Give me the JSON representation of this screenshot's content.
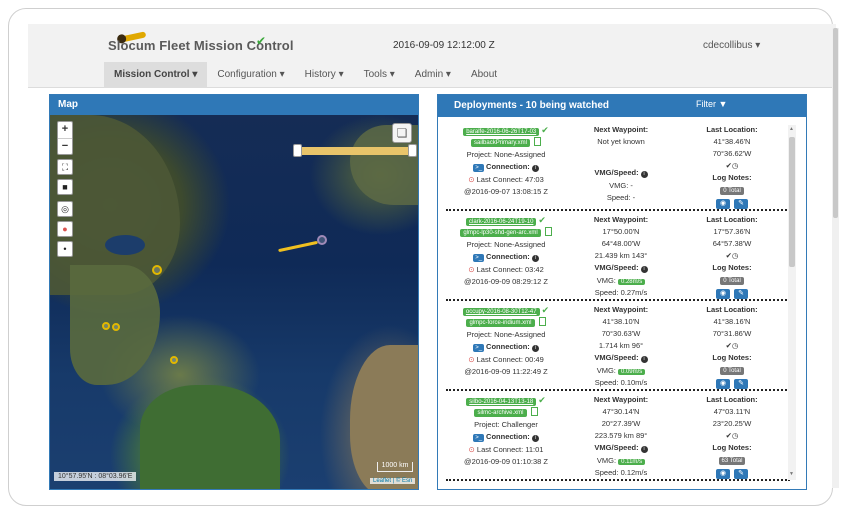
{
  "header": {
    "title": "Slocum Fleet Mission Control",
    "datetime": "2016-09-09 12:12:00 Z",
    "user": "cdecollibus"
  },
  "nav": [
    {
      "label": "Mission Control",
      "active": true
    },
    {
      "label": "Configuration"
    },
    {
      "label": "History"
    },
    {
      "label": "Tools"
    },
    {
      "label": "Admin"
    },
    {
      "label": "About"
    }
  ],
  "map": {
    "title": "Map",
    "coords": "10°57.95'N : 08°03.96'E",
    "scale": "1000 km",
    "attribution": "Leaflet | © Esri"
  },
  "deployments": {
    "title": "Deployments - 10 being watched",
    "filter_label": "Filter",
    "labels": {
      "next_waypoint": "Next Waypoint:",
      "last_location": "Last Location:",
      "connection": "Connection:",
      "vmg_speed": "VMG/Speed:",
      "log_notes": "Log Notes:"
    },
    "items": [
      {
        "name": "baralfe-2016-06-26T17-03",
        "mission_file": "sailbackPrimary.xml",
        "project": "Project: None-Assigned",
        "last_connect": "Last Connect: 47:03",
        "connect_time": "@2016-09-07 13:08:15 Z",
        "waypoint_lines": [
          "Not yet known"
        ],
        "vmg": "VMG: -",
        "speed": "Speed: -",
        "lat": "41°38.46'N",
        "lon": "70°36.62'W",
        "log_total": "0 Total"
      },
      {
        "name": "clark-2016-06-24T19-10",
        "mission_file": "glmpc-lp30-shd-gen-arc.xml",
        "project": "Project: None-Assigned",
        "last_connect": "Last Connect: 03:42",
        "connect_time": "@2016-09-09 08:29:12 Z",
        "waypoint_lines": [
          "17°50.00'N",
          "64°48.00'W",
          "21.439 km 143°"
        ],
        "vmg": "0.28m/s",
        "speed": "Speed: 0.27m/s",
        "lat": "17°57.36'N",
        "lon": "64°57.38'W",
        "log_total": "0 Total"
      },
      {
        "name": "occupy-2016-08-30T12-47",
        "mission_file": "glmpc-force-iridium.xml",
        "project": "Project: None-Assigned",
        "last_connect": "Last Connect: 00:49",
        "connect_time": "@2016-09-09 11:22:49 Z",
        "waypoint_lines": [
          "41°38.10'N",
          "70°30.63'W",
          "1.714 km 96°"
        ],
        "vmg": "0.09m/s",
        "speed": "Speed: 0.10m/s",
        "lat": "41°38.16'N",
        "lon": "70°31.86'W",
        "log_total": "0 Total"
      },
      {
        "name": "silbo-2016-04-13T13-18",
        "mission_file": "silmc-archive.xml",
        "project": "Project: Challenger",
        "last_connect": "Last Connect: 11:01",
        "connect_time": "@2016-09-09 01:10:38 Z",
        "waypoint_lines": [
          "47°30.14'N",
          "20°27.39'W",
          "223.579 km 89°"
        ],
        "vmg": "0.11m/s",
        "speed": "Speed: 0.12m/s",
        "lat": "47°03.11'N",
        "lon": "23°20.25'W",
        "log_total": "63 Total"
      }
    ]
  },
  "colors": {
    "panel_header": "#2f78b7",
    "badge_green": "#4cae4c",
    "ocean": "#0f2a57",
    "track": "#f0c020"
  },
  "icons": [
    "check-icon",
    "filter-icon",
    "layers-icon",
    "terminal-icon",
    "info-icon",
    "alert-circle-icon",
    "clock-icon",
    "eye-icon",
    "edit-icon",
    "document-icon"
  ]
}
